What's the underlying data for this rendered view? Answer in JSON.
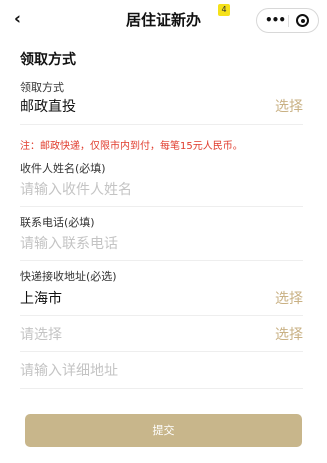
{
  "nav": {
    "back_icon": "‹",
    "title": "居住证新办",
    "badge": "4",
    "more_icon": "•••",
    "close_icon": "target-circle"
  },
  "section": {
    "title": "领取方式"
  },
  "fields": {
    "pickup_method": {
      "label": "领取方式",
      "value": "邮政直投",
      "action": "选择"
    },
    "notice": "注：邮政快递，仅限市内到付，每笔15元人民币。",
    "recipient_name": {
      "label": "收件人姓名(必填)",
      "placeholder": "请输入收件人姓名"
    },
    "phone": {
      "label": "联系电话(必填)",
      "placeholder": "请输入联系电话"
    },
    "address": {
      "label": "快递接收地址(必选)",
      "city": "上海市",
      "city_action": "选择",
      "district_placeholder": "请选择",
      "district_action": "选择",
      "detail_placeholder": "请输入详细地址"
    }
  },
  "submit": {
    "label": "提交"
  },
  "colors": {
    "accent": "#c9b184",
    "button": "#c8b68b",
    "notice": "#e03b2c",
    "placeholder": "#c4c4c4"
  }
}
